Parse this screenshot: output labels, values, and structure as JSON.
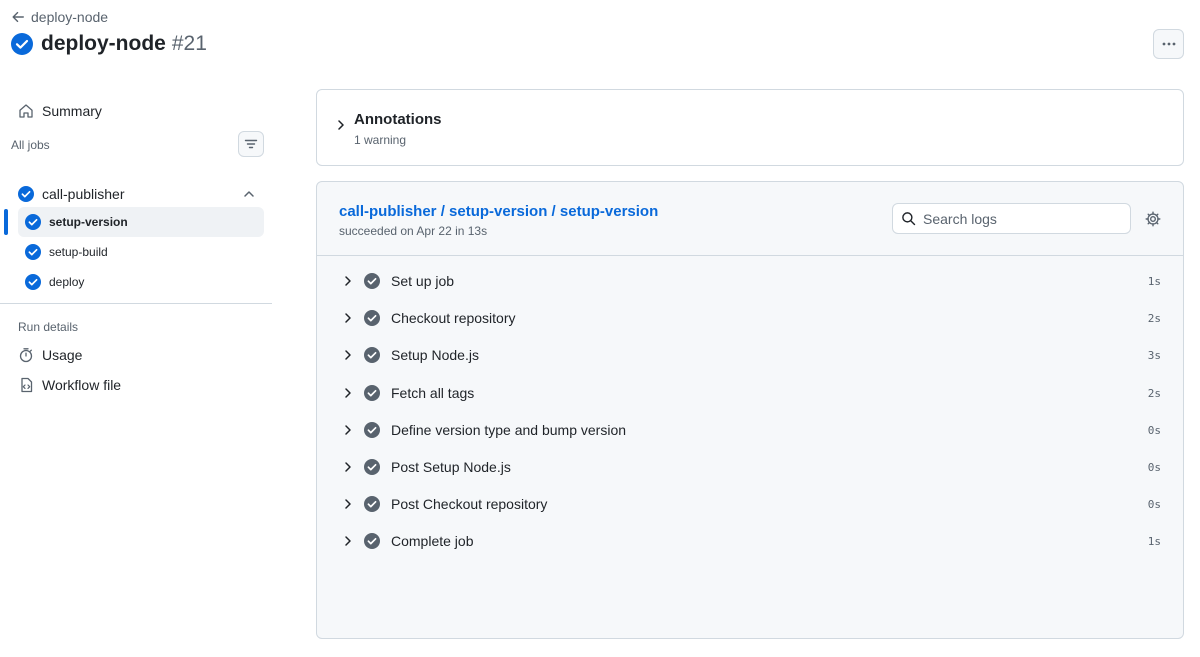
{
  "header": {
    "back_label": "deploy-node",
    "workflow_name": "deploy-node",
    "run_number": "#21"
  },
  "sidebar": {
    "summary_label": "Summary",
    "all_jobs_label": "All jobs",
    "group": {
      "label": "call-publisher"
    },
    "jobs": [
      {
        "label": "setup-version",
        "active": true
      },
      {
        "label": "setup-build"
      },
      {
        "label": "deploy"
      }
    ],
    "run_details_label": "Run details",
    "usage_label": "Usage",
    "workflow_file_label": "Workflow file"
  },
  "annotations": {
    "title": "Annotations",
    "subtitle": "1 warning"
  },
  "log": {
    "job_path": "call-publisher / setup-version / setup-version",
    "status": "succeeded on Apr 22 in 13s",
    "search_placeholder": "Search logs",
    "steps": [
      {
        "name": "Set up job",
        "duration": "1s"
      },
      {
        "name": "Checkout repository",
        "duration": "2s"
      },
      {
        "name": "Setup Node.js",
        "duration": "3s"
      },
      {
        "name": "Fetch all tags",
        "duration": "2s"
      },
      {
        "name": "Define version type and bump version",
        "duration": "0s"
      },
      {
        "name": "Post Setup Node.js",
        "duration": "0s"
      },
      {
        "name": "Post Checkout repository",
        "duration": "0s"
      },
      {
        "name": "Complete job",
        "duration": "1s"
      }
    ]
  },
  "colors": {
    "success_blue": "#0969da",
    "step_check_gray": "#59636e",
    "panel_bg": "#f6f8fa",
    "border": "#d1d9e0"
  }
}
